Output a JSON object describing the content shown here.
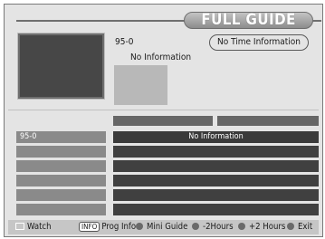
{
  "header": {
    "title": "FULL GUIDE"
  },
  "current": {
    "channel": "95-0",
    "program_info": "No Information",
    "time_info": "No Time Information"
  },
  "guide": {
    "rows": [
      {
        "channel": "95-0",
        "program": "No Information"
      },
      {
        "channel": "",
        "program": ""
      },
      {
        "channel": "",
        "program": ""
      },
      {
        "channel": "",
        "program": ""
      },
      {
        "channel": "",
        "program": ""
      },
      {
        "channel": "",
        "program": ""
      }
    ]
  },
  "footer": {
    "watch": "Watch",
    "info_key": "INFO",
    "prog_info": "Prog Info",
    "mini_guide": "Mini Guide",
    "minus_2h": "-2Hours",
    "plus_2h": "+2 Hours",
    "exit": "Exit"
  },
  "colors": {
    "button_dot": "#6a6a6a",
    "channel_cell": "#8a8a8a",
    "program_cell": "#404040"
  }
}
